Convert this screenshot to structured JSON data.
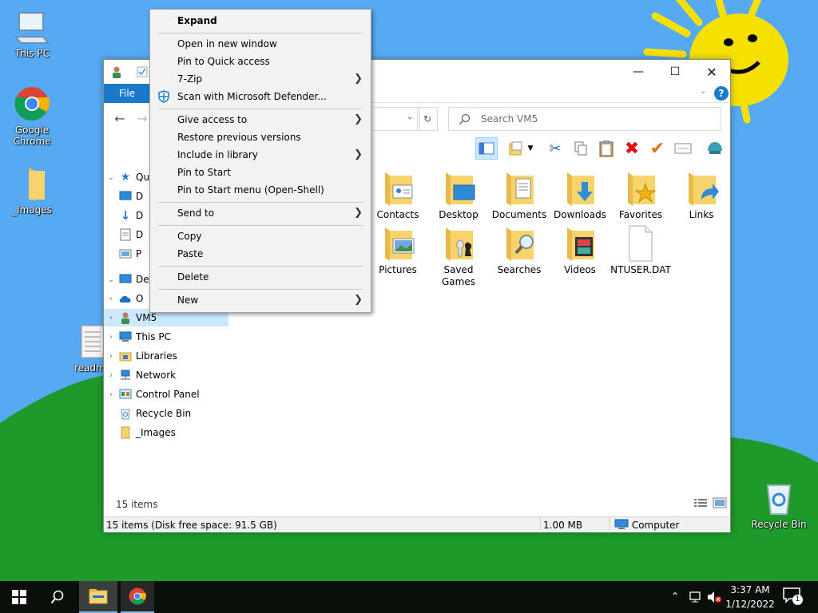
{
  "desktop": {
    "icons": [
      {
        "label": "This PC"
      },
      {
        "label": "Google Chrome"
      },
      {
        "label": "_Images"
      },
      {
        "label": "readme"
      },
      {
        "label": "Recycle Bin"
      }
    ]
  },
  "explorer": {
    "ribbon": {
      "file_tab": "File"
    },
    "search": {
      "placeholder": "Search VM5"
    },
    "nav_pane": {
      "items": [
        {
          "label": "Qu",
          "icon": "star-icon",
          "expanded": true
        },
        {
          "label": "D",
          "icon": "desktop-icon"
        },
        {
          "label": "D",
          "icon": "download-icon"
        },
        {
          "label": "D",
          "icon": "document-icon"
        },
        {
          "label": "P",
          "icon": "picture-icon"
        },
        {
          "label": "De",
          "icon": "desktop-icon",
          "expanded": true
        },
        {
          "label": "O",
          "icon": "cloud-icon"
        },
        {
          "label": "VM5",
          "icon": "user-icon",
          "selected": true
        },
        {
          "label": "This PC",
          "icon": "pc-icon"
        },
        {
          "label": "Libraries",
          "icon": "library-icon"
        },
        {
          "label": "Network",
          "icon": "network-icon"
        },
        {
          "label": "Control Panel",
          "icon": "control-panel-icon"
        },
        {
          "label": "Recycle Bin",
          "icon": "recycle-bin-icon"
        },
        {
          "label": "_Images",
          "icon": "folder-icon"
        }
      ]
    },
    "files": [
      {
        "label": "Contacts",
        "icon": "contacts-folder-icon"
      },
      {
        "label": "Desktop",
        "icon": "desktop-folder-icon"
      },
      {
        "label": "Documents",
        "icon": "documents-folder-icon"
      },
      {
        "label": "Downloads",
        "icon": "downloads-folder-icon"
      },
      {
        "label": "Favorites",
        "icon": "favorites-folder-icon"
      },
      {
        "label": "Links",
        "icon": "links-folder-icon"
      },
      {
        "label": "Pictures",
        "icon": "pictures-folder-icon"
      },
      {
        "label": "Saved Games",
        "icon": "saved-games-folder-icon"
      },
      {
        "label": "Searches",
        "icon": "searches-folder-icon"
      },
      {
        "label": "Videos",
        "icon": "videos-folder-icon"
      },
      {
        "label": "NTUSER.DAT",
        "icon": "file-icon"
      }
    ],
    "items_count": "15 items",
    "status": {
      "left": "15 items (Disk free space: 91.5 GB)",
      "size": "1.00 MB",
      "location": "Computer"
    }
  },
  "context_menu": {
    "items": [
      {
        "label": "Expand",
        "bold": true
      },
      {
        "label": "Open in new window"
      },
      {
        "label": "Pin to Quick access"
      },
      {
        "label": "7-Zip",
        "submenu": true
      },
      {
        "label": "Scan with Microsoft Defender...",
        "icon": "defender-icon"
      },
      {
        "label": "Give access to",
        "submenu": true
      },
      {
        "label": "Restore previous versions"
      },
      {
        "label": "Include in library",
        "submenu": true
      },
      {
        "label": "Pin to Start"
      },
      {
        "label": "Pin to Start menu (Open-Shell)"
      },
      {
        "label": "Send to",
        "submenu": true
      },
      {
        "label": "Copy"
      },
      {
        "label": "Paste"
      },
      {
        "label": "Delete"
      },
      {
        "label": "New",
        "submenu": true
      }
    ]
  },
  "taskbar": {
    "time": "3:37 AM",
    "date": "1/12/2022",
    "notification_count": "1"
  },
  "colors": {
    "desktop_sky": "#56aaf3",
    "hill": "#1e9a2a",
    "accent": "#1979ca",
    "selection": "#cce8ff",
    "folder": "#f7d36b"
  }
}
